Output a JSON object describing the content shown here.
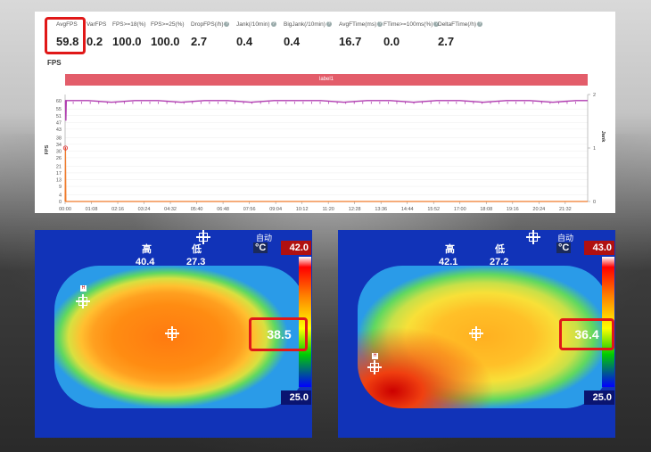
{
  "metrics": [
    {
      "label": "AvgFPS",
      "value": "59.8",
      "info": false
    },
    {
      "label": "VarFPS",
      "value": "0.2",
      "info": false
    },
    {
      "label": "FPS>=18(%)",
      "value": "100.0",
      "info": false
    },
    {
      "label": "FPS>=25(%)",
      "value": "100.0",
      "info": false
    },
    {
      "label": "DropFPS(/h)",
      "value": "2.7",
      "info": true
    },
    {
      "label": "Jank(/10min)",
      "value": "0.4",
      "info": true
    },
    {
      "label": "BigJank(/10min)",
      "value": "0.4",
      "info": true
    },
    {
      "label": "AvgFTime(ms)",
      "value": "16.7",
      "info": true
    },
    {
      "label": "FTime>=100ms(%)",
      "value": "0.0",
      "info": true
    },
    {
      "label": "DeltaFTime(/h)",
      "value": "2.7",
      "info": true
    }
  ],
  "section_title": "FPS",
  "label_bar": "label1",
  "colors": {
    "fps_line": "#b03bb0",
    "jank_line": "#f07a2a",
    "label_bar": "#e35d6a",
    "highlight": "#e01818"
  },
  "chart_data": {
    "type": "line",
    "ylabel": "FPS",
    "y2label": "Jank",
    "ylim": [
      0,
      62
    ],
    "y2lim": [
      0,
      2
    ],
    "yticks": [
      0,
      4,
      9,
      13,
      17,
      21,
      26,
      30,
      34,
      38,
      43,
      47,
      51,
      55,
      60
    ],
    "y2ticks": [
      0,
      1,
      2
    ],
    "xticks": [
      "00:00",
      "01:08",
      "02:16",
      "03:24",
      "04:32",
      "05:40",
      "06:48",
      "07:56",
      "09:04",
      "10:12",
      "11:20",
      "12:28",
      "13:36",
      "14:44",
      "15:52",
      "17:00",
      "18:08",
      "19:16",
      "20:24",
      "21:32"
    ],
    "xlim_minutes": [
      0,
      1350
    ],
    "series": [
      {
        "name": "FPS",
        "points": [
          [
            0,
            60
          ],
          [
            1,
            60
          ],
          [
            2,
            48
          ],
          [
            3,
            60
          ],
          [
            60,
            60
          ],
          [
            120,
            59
          ],
          [
            180,
            60
          ],
          [
            240,
            60
          ],
          [
            300,
            59
          ],
          [
            360,
            60
          ],
          [
            420,
            60
          ],
          [
            480,
            59
          ],
          [
            540,
            60
          ],
          [
            600,
            60
          ],
          [
            660,
            60
          ],
          [
            720,
            59
          ],
          [
            780,
            60
          ],
          [
            840,
            60
          ],
          [
            900,
            59
          ],
          [
            960,
            60
          ],
          [
            1020,
            60
          ],
          [
            1080,
            59
          ],
          [
            1140,
            60
          ],
          [
            1200,
            60
          ],
          [
            1260,
            59
          ],
          [
            1320,
            60
          ],
          [
            1350,
            60
          ]
        ]
      },
      {
        "name": "Jank",
        "axis": "right",
        "points": [
          [
            0,
            0
          ],
          [
            1,
            1
          ],
          [
            2,
            0
          ],
          [
            1350,
            0
          ]
        ]
      }
    ]
  },
  "thermal_left": {
    "high_label": "高",
    "low_label": "低",
    "high_value": "40.4",
    "low_value": "27.3",
    "auto_label": "自动",
    "unit": "°C",
    "scale_max": "42.0",
    "scale_min": "25.0",
    "spot_value": "38.5"
  },
  "thermal_right": {
    "high_label": "高",
    "low_label": "低",
    "high_value": "42.1",
    "low_value": "27.2",
    "auto_label": "自动",
    "unit": "°C",
    "scale_max": "43.0",
    "scale_min": "25.0",
    "spot_value": "36.4"
  }
}
